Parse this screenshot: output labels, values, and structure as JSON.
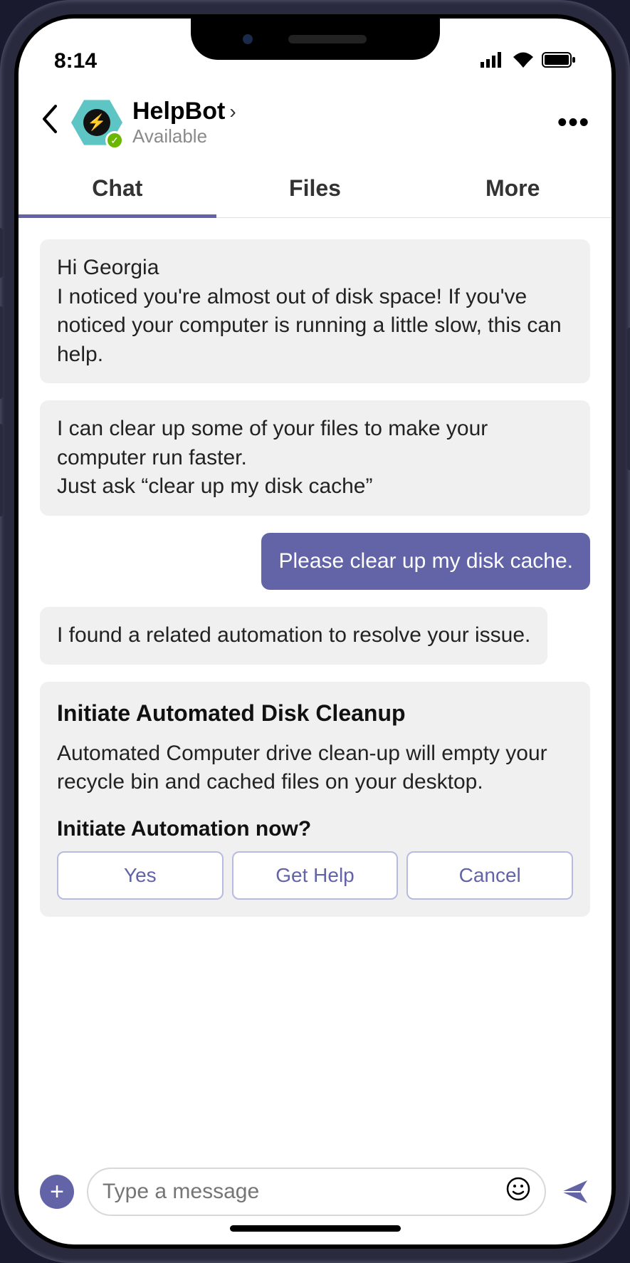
{
  "status_bar": {
    "time": "8:14"
  },
  "header": {
    "bot_name": "HelpBot",
    "presence": "Available"
  },
  "tabs": {
    "chat": "Chat",
    "files": "Files",
    "more": "More"
  },
  "messages": [
    {
      "from": "bot",
      "text": "Hi Georgia\nI noticed you're almost out of disk space! If you've noticed your computer is running a little slow, this can help."
    },
    {
      "from": "bot",
      "text": "I can clear up some of your files to make your computer run faster.\nJust ask “clear up my disk cache”"
    },
    {
      "from": "user",
      "text": "Please clear up my disk cache."
    },
    {
      "from": "bot",
      "text": "I found a related automation to resolve your issue."
    }
  ],
  "card": {
    "title": "Initiate Automated Disk Cleanup",
    "description": "Automated Computer drive clean-up will empty your recycle bin and cached files on your desktop.",
    "prompt": "Initiate Automation now?",
    "buttons": {
      "yes": "Yes",
      "help": "Get Help",
      "cancel": "Cancel"
    }
  },
  "composer": {
    "placeholder": "Type a message"
  }
}
